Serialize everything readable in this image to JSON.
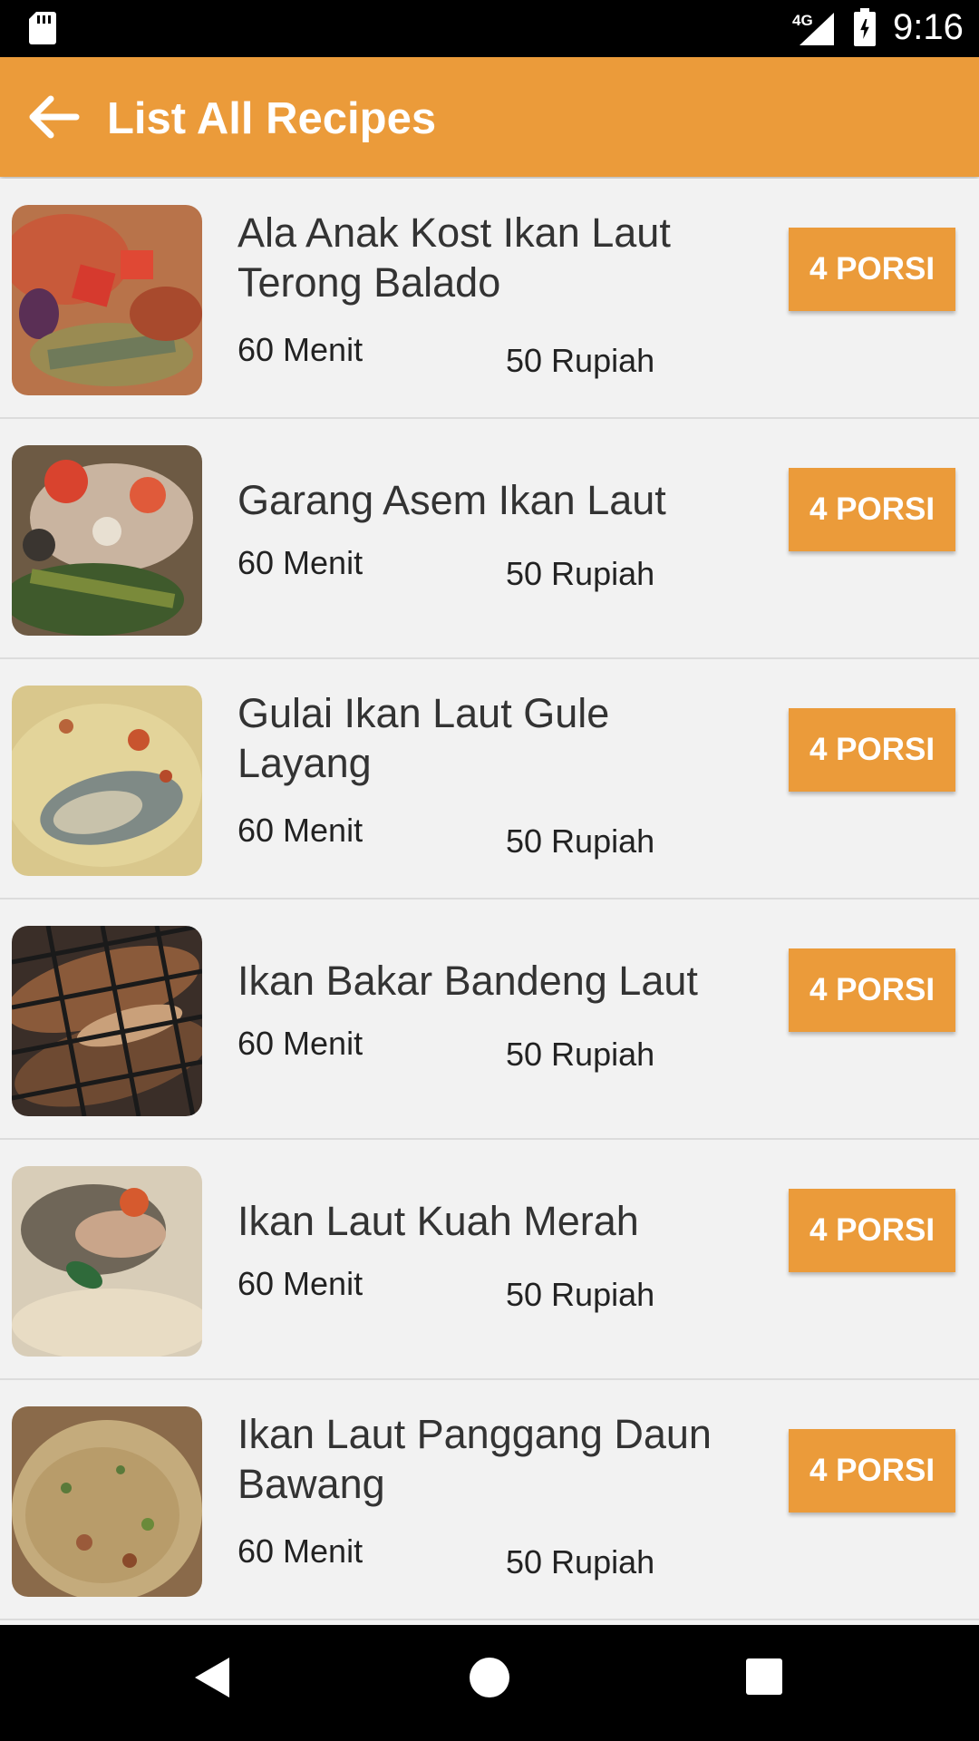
{
  "status_bar": {
    "time": "9:16",
    "network": "4G"
  },
  "app_bar": {
    "title": "List All Recipes",
    "back_icon": "arrow-left-icon",
    "color": "#eb9b3a"
  },
  "recipes": [
    {
      "title": "Ala Anak Kost  Ikan Laut Terong Balado",
      "time": "60 Menit",
      "price": "50 Rupiah",
      "portion": "4 PORSI"
    },
    {
      "title": "Garang Asem Ikan Laut",
      "time": "60 Menit",
      "price": "50 Rupiah",
      "portion": "4 PORSI"
    },
    {
      "title": "Gulai Ikan Laut  Gule Layang",
      "time": "60 Menit",
      "price": "50 Rupiah",
      "portion": "4 PORSI"
    },
    {
      "title": "Ikan Bakar Bandeng Laut",
      "time": "60 Menit",
      "price": "50 Rupiah",
      "portion": "4 PORSI"
    },
    {
      "title": "Ikan Laut Kuah Merah",
      "time": "60 Menit",
      "price": "50 Rupiah",
      "portion": "4 PORSI"
    },
    {
      "title": "Ikan Laut Panggang Daun Bawang",
      "time": "60 Menit",
      "price": "50 Rupiah",
      "portion": "4 PORSI"
    }
  ],
  "nav_bar": {
    "back_icon": "triangle-back-icon",
    "home_icon": "circle-home-icon",
    "recent_icon": "square-recents-icon"
  }
}
